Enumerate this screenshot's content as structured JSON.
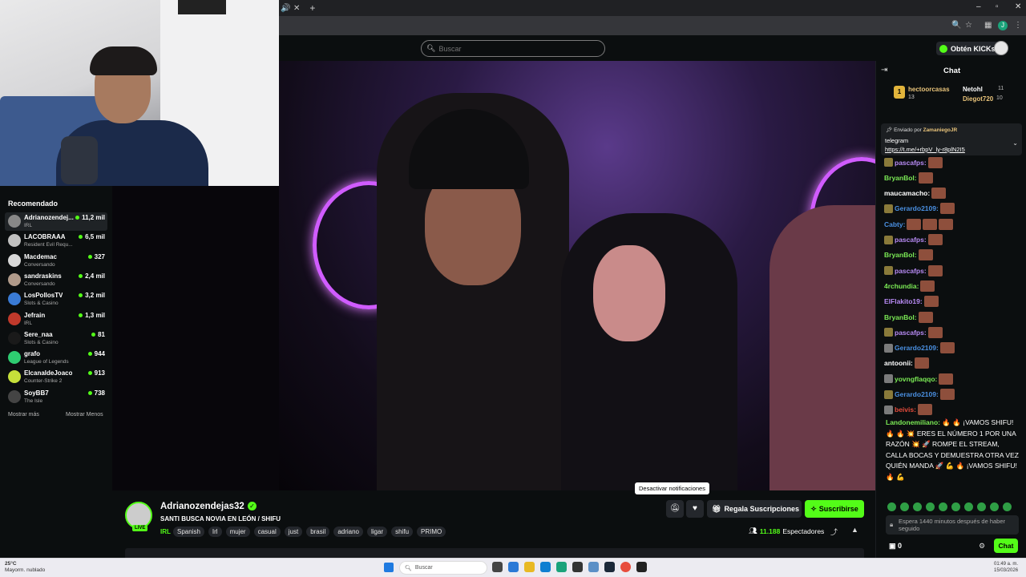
{
  "browser": {
    "profile_initial": "J"
  },
  "header": {
    "search_placeholder": "Buscar",
    "kicks_label": "Obtén KICKs"
  },
  "sidebar": {
    "title": "Recomendado",
    "channels": [
      {
        "name": "Adrianozendej...",
        "category": "IRL",
        "viewers": "11,2 mil",
        "color": "#888888"
      },
      {
        "name": "LACOBRAAA",
        "category": "Resident Evil Requ...",
        "viewers": "6,5 mil",
        "color": "#c0c0c0"
      },
      {
        "name": "Macdemac",
        "category": "Conversando",
        "viewers": "327",
        "color": "#d8d8d8"
      },
      {
        "name": "sandraskins",
        "category": "Conversando",
        "viewers": "2,4 mil",
        "color": "#b09a8a"
      },
      {
        "name": "LosPollosTV",
        "category": "Slots & Casino",
        "viewers": "3,2 mil",
        "color": "#3a7bd5"
      },
      {
        "name": "Jefrain",
        "category": "IRL",
        "viewers": "1,3 mil",
        "color": "#c0392b"
      },
      {
        "name": "Sere_naa",
        "category": "Slots & Casino",
        "viewers": "81",
        "color": "#1a1a1a"
      },
      {
        "name": "grafo",
        "category": "League of Legends",
        "viewers": "944",
        "color": "#2ecc71"
      },
      {
        "name": "ElcanaldeJoaco",
        "category": "Counter-Strike 2",
        "viewers": "913",
        "color": "#c6e03a"
      },
      {
        "name": "SoyBB7",
        "category": "The Isle",
        "viewers": "738",
        "color": "#444444"
      }
    ],
    "show_more": "Mostrar más",
    "show_less": "Mostrar Menos"
  },
  "stream": {
    "channel_name": "Adrianozendejas32",
    "live_badge": "LIVE",
    "title": "SANTI BUSCA NOVIA EN LEÓN / SHIFU",
    "category": "IRL",
    "tags": [
      "Spanish",
      "Irl",
      "mujer",
      "casual",
      "just",
      "brasil",
      "adriano",
      "ligar",
      "shifu",
      "PRIMO"
    ],
    "gift_label": "Regala Suscripciones",
    "subscribe_label": "Suscribirse",
    "viewers": "11.188",
    "viewers_label": "Espectadores",
    "tooltip": "Desactivar notificaciones"
  },
  "chat": {
    "title": "Chat",
    "top_gifters": [
      {
        "rank": "1",
        "name": "hectoorcasas",
        "count": "13"
      },
      {
        "name": "Netohl",
        "count": "11"
      },
      {
        "name": "Diegot720",
        "count": "10"
      }
    ],
    "pinned": {
      "sent_by_label": "Enviado por",
      "sent_by_user": "ZamaniegoJR",
      "message": "telegram",
      "link": "https://t.me/+rbpV_ly-r8plN2I5"
    },
    "messages": [
      {
        "user": "pascafps:",
        "color": "#b88bf5",
        "badge": "gold",
        "emotes": 1
      },
      {
        "user": "BryanBol:",
        "color": "#7bea55",
        "badge": "",
        "emotes": 1
      },
      {
        "user": "maucamacho:",
        "color": "#ffffff",
        "badge": "",
        "emotes": 1
      },
      {
        "user": "Gerardo2109:",
        "color": "#4a90e2",
        "badge": "gold",
        "emotes": 1
      },
      {
        "user": "Cabty:",
        "color": "#4a90e2",
        "badge": "",
        "emotes": 3
      },
      {
        "user": "pascafps:",
        "color": "#b88bf5",
        "badge": "gold",
        "emotes": 1
      },
      {
        "user": "BryanBol:",
        "color": "#7bea55",
        "badge": "",
        "emotes": 1
      },
      {
        "user": "pascafps:",
        "color": "#b88bf5",
        "badge": "gold",
        "emotes": 1
      },
      {
        "user": "4rchundia:",
        "color": "#7bea55",
        "badge": "",
        "emotes": 1
      },
      {
        "user": "ElFlakito19:",
        "color": "#b88bf5",
        "badge": "",
        "emotes": 1
      },
      {
        "user": "BryanBol:",
        "color": "#7bea55",
        "badge": "",
        "emotes": 1
      },
      {
        "user": "pascafps:",
        "color": "#b88bf5",
        "badge": "gold",
        "emotes": 1
      },
      {
        "user": "Gerardo2109:",
        "color": "#4a90e2",
        "badge": "grey",
        "emotes": 1
      },
      {
        "user": "antoonii:",
        "color": "#ffffff",
        "badge": "",
        "emotes": 1
      },
      {
        "user": "yovngflaqqo:",
        "color": "#7bea55",
        "badge": "grey",
        "emotes": 1
      },
      {
        "user": "Gerardo2109:",
        "color": "#4a90e2",
        "badge": "gold",
        "emotes": 1
      },
      {
        "user": "beivis:",
        "color": "#e74c3c",
        "badge": "grey",
        "emotes": 1
      }
    ],
    "long_message_user": "Landonemiliano:",
    "long_message_text": "🔥 🔥 ¡VAMOS SHIFU! 🔥 🔥 💥 ERES EL NÚMERO 1 POR UNA RAZÓN 💥 🚀 ROMPE EL STREAM, CALLA BOCAS Y DEMUESTRA OTRA VEZ QUIÉN MANDA 🚀 💪 🔥 ¡VAMOS SHIFU! 🔥 💪",
    "input_placeholder": "Espera 1440 minutos después de haber seguido",
    "points": "0",
    "send_label": "Chat"
  },
  "taskbar": {
    "temperature": "25°C",
    "weather": "Mayorm. nublado",
    "search_label": "Buscar",
    "time": "01:49 a. m.",
    "date": "15/03/2026"
  }
}
